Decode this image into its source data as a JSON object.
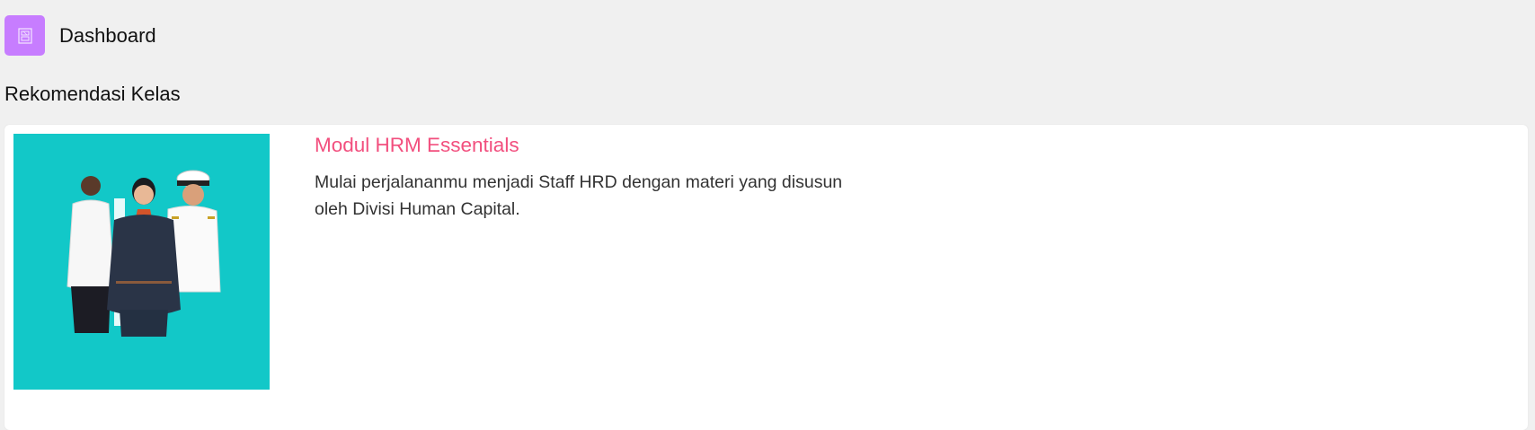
{
  "header": {
    "title": "Dashboard",
    "icon": "report-icon",
    "icon_color": "#c77dff"
  },
  "section": {
    "title": "Rekomendasi Kelas"
  },
  "course": {
    "title": "Modul HRM Essentials",
    "description": "Mulai perjalananmu menjadi Staff HRD dengan materi yang disusun oleh Divisi Human Capital.",
    "image_background": "#12c8c8",
    "title_color": "#f24f7e"
  }
}
